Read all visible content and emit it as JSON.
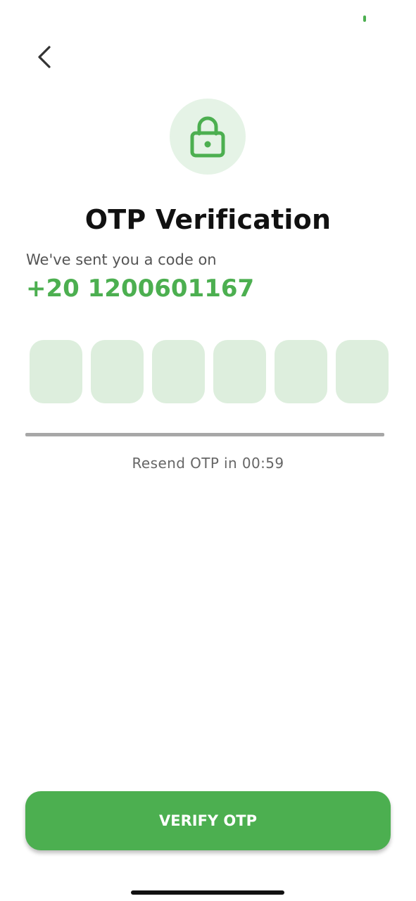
{
  "colors": {
    "accent": "#4caf50",
    "otp_box": "#ddeedd",
    "lock_circle_bg": "#e5f3e6",
    "divider": "#a7a7a7"
  },
  "header": {
    "back_icon": "chevron-left-icon"
  },
  "hero": {
    "icon": "lock-icon",
    "title": "OTP Verification"
  },
  "info": {
    "subtitle": "We've sent you a code on",
    "phone": "+20 1200601167"
  },
  "otp": {
    "digits": [
      "",
      "",
      "",
      "",
      "",
      ""
    ]
  },
  "resend": {
    "text": "Resend OTP in 00:59"
  },
  "actions": {
    "verify_label": "VERIFY OTP"
  }
}
